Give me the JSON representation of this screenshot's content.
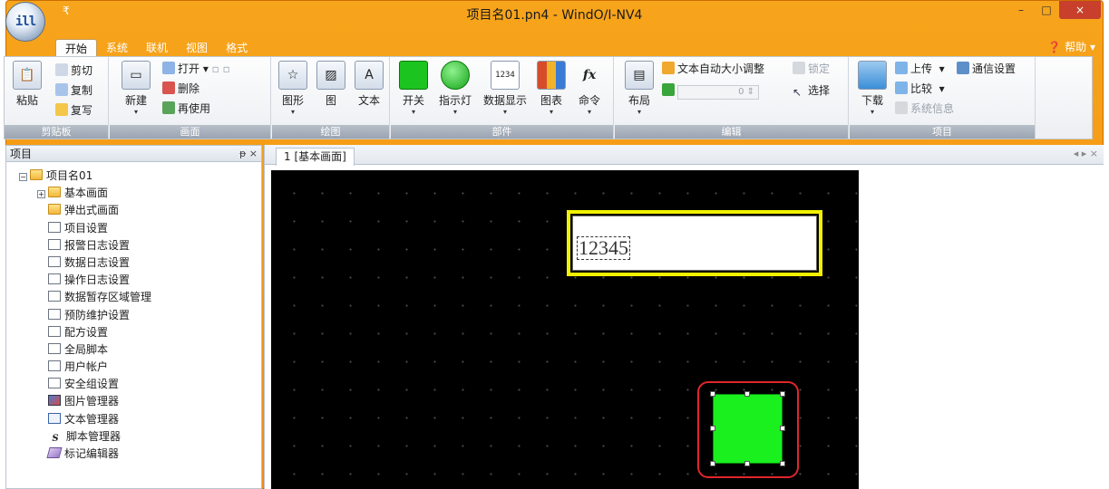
{
  "window": {
    "title": "项目名01.pn4 - WindO/I-NV4",
    "qat_symbol": "₹",
    "orb_label": "ill",
    "controls": {
      "minimize": "–",
      "maximize": "□",
      "close": "×"
    }
  },
  "menu": {
    "tabs": [
      "开始",
      "系统",
      "联机",
      "视图",
      "格式"
    ],
    "active_tab": "开始",
    "help": "帮助 ▾"
  },
  "ribbon": {
    "clipboard": {
      "label": "剪贴板",
      "paste": "粘贴",
      "cut": "剪切",
      "copy": "复制",
      "format_copy": "复写"
    },
    "screen": {
      "label": "画面",
      "new": "新建",
      "open": "打开",
      "delete": "删除",
      "reuse": "再使用"
    },
    "draw": {
      "label": "绘图",
      "shape": "图形",
      "image": "图",
      "text": "文本"
    },
    "parts": {
      "label": "部件",
      "switch": "开关",
      "indicator": "指示灯",
      "numeric": "数据显示",
      "chart": "图表",
      "command": "命令",
      "numeric_icon": "1234",
      "command_icon": "fx"
    },
    "edit": {
      "label": "编辑",
      "layout": "布局",
      "auto_size": "文本自动大小调整",
      "fixed": "锁定",
      "select": "选择"
    },
    "project": {
      "label": "项目",
      "download": "下载",
      "upload": "上传",
      "compare": "比较",
      "system_info": "系统信息",
      "comm_settings": "通信设置"
    }
  },
  "project_pane": {
    "title": "项目",
    "controls": "ᵽ ×",
    "root": "项目名01",
    "items": [
      "基本画面",
      "弹出式画面",
      "项目设置",
      "报警日志设置",
      "数据日志设置",
      "操作日志设置",
      "数据暂存区域管理",
      "预防维护设置",
      "配方设置",
      "全局脚本",
      "用户帐户",
      "安全组设置",
      "图片管理器",
      "文本管理器",
      "脚本管理器",
      "标记编辑器"
    ]
  },
  "editor": {
    "tab_label": "1  [基本画面]",
    "tab_controls": "◂ ▸ ×",
    "numeric_display_value": "12345"
  },
  "colors": {
    "title_bar": "#f28a0b",
    "canvas": "#000000",
    "display_frame": "#f2f200",
    "switch_fill": "#19f01e",
    "selection_highlight": "#e0262b"
  }
}
